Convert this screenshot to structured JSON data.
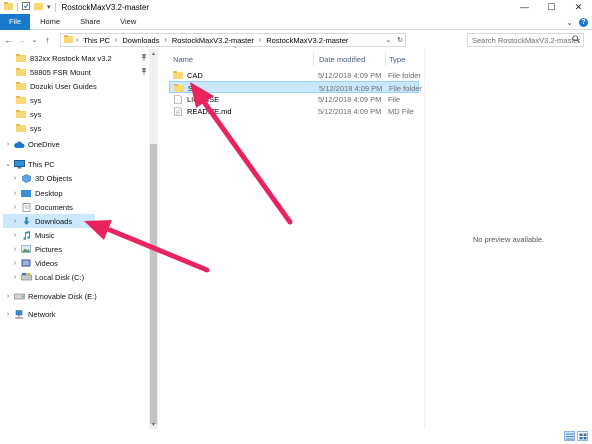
{
  "window": {
    "title": "RostockMaxV3.2-master",
    "dropdown_glyph": "▾",
    "controls": {
      "minimize": "—",
      "maximize": "☐",
      "close": "✕"
    }
  },
  "ribbon": {
    "tabs": [
      {
        "label": "File",
        "active": true
      },
      {
        "label": "Home",
        "active": false
      },
      {
        "label": "Share",
        "active": false
      },
      {
        "label": "View",
        "active": false
      }
    ],
    "expand_glyph": "⌄",
    "help_glyph": "?"
  },
  "nav_buttons": {
    "back": "←",
    "forward": "→",
    "recent": "⌄",
    "up": "↑"
  },
  "address": {
    "crumbs": [
      "This PC",
      "Downloads",
      "RostockMaxV3.2-master",
      "RostockMaxV3.2-master"
    ],
    "separator": "›",
    "dropdown_glyph": "⌄",
    "refresh_glyph": "↻"
  },
  "search": {
    "placeholder": "Search RostockMaxV3.2-master",
    "icon": "search-icon"
  },
  "nav_pane": {
    "quick_access": [
      {
        "label": "832xx Rostock Max v3.2",
        "pinned": true
      },
      {
        "label": "58805 FSR Mount",
        "pinned": true
      },
      {
        "label": "Dozuki User Guides",
        "pinned": false
      },
      {
        "label": "sys",
        "pinned": false
      },
      {
        "label": "sys",
        "pinned": false
      },
      {
        "label": "sys",
        "pinned": false
      }
    ],
    "onedrive": "OneDrive",
    "this_pc": "This PC",
    "this_pc_children": [
      {
        "label": "3D Objects",
        "icon": "3d-objects-icon"
      },
      {
        "label": "Desktop",
        "icon": "desktop-folder-icon"
      },
      {
        "label": "Documents",
        "icon": "documents-icon"
      },
      {
        "label": "Downloads",
        "icon": "downloads-icon",
        "selected": true
      },
      {
        "label": "Music",
        "icon": "music-icon"
      },
      {
        "label": "Pictures",
        "icon": "pictures-icon"
      },
      {
        "label": "Videos",
        "icon": "videos-icon"
      },
      {
        "label": "Local Disk (C:)",
        "icon": "local-disk-icon"
      }
    ],
    "removable": "Removable Disk (E:)",
    "network": "Network",
    "pin_glyph": "📌"
  },
  "file_list": {
    "sort_glyph": "⌃",
    "columns": {
      "name": "Name",
      "date": "Date modified",
      "type": "Type"
    },
    "rows": [
      {
        "name": "CAD",
        "date": "5/12/2018 4:09 PM",
        "type": "File folder",
        "icon": "folder-icon",
        "selected": false
      },
      {
        "name": "SD",
        "date": "5/12/2018 4:09 PM",
        "type": "File folder",
        "icon": "folder-icon",
        "selected": true
      },
      {
        "name": "LICENSE",
        "date": "5/12/2018 4:09 PM",
        "type": "File",
        "icon": "file-icon",
        "selected": false
      },
      {
        "name": "README.md",
        "date": "5/12/2018 4:09 PM",
        "type": "MD File",
        "icon": "md-file-icon",
        "selected": false
      }
    ]
  },
  "preview": {
    "text": "No preview available."
  },
  "colors": {
    "accent": "#1979ca",
    "selection": "#cce8ff",
    "folder": "#f8d775",
    "annotation_arrow": "#e8235e"
  }
}
